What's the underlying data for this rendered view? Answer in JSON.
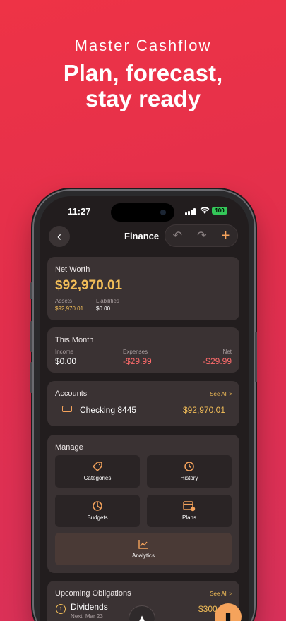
{
  "promo": {
    "subtitle": "Master Cashflow",
    "title_line1": "Plan, forecast,",
    "title_line2": "stay ready"
  },
  "status_bar": {
    "time": "11:27",
    "battery": "100"
  },
  "nav": {
    "title": "Finance",
    "icons": [
      "back-icon",
      "undo-icon",
      "redo-icon",
      "plus-icon"
    ]
  },
  "net_worth": {
    "title": "Net Worth",
    "amount": "$92,970.01",
    "assets_label": "Assets",
    "assets_value": "$92,970.01",
    "liabilities_label": "Liabilities",
    "liabilities_value": "$0.00"
  },
  "this_month": {
    "title": "This Month",
    "income_label": "Income",
    "income_value": "$0.00",
    "expenses_label": "Expenses",
    "expenses_value": "-$29.99",
    "net_label": "Net",
    "net_value": "-$29.99"
  },
  "accounts": {
    "title": "Accounts",
    "see_all": "See All >",
    "items": [
      {
        "name": "Checking 8445",
        "balance": "$92,970.01",
        "icon": "bank-card-icon"
      }
    ]
  },
  "manage": {
    "title": "Manage",
    "items": [
      {
        "label": "Categories",
        "icon": "tag-icon"
      },
      {
        "label": "History",
        "icon": "history-icon"
      },
      {
        "label": "Budgets",
        "icon": "pie-chart-icon"
      },
      {
        "label": "Plans",
        "icon": "calendar-icon"
      },
      {
        "label": "Analytics",
        "icon": "line-chart-icon"
      }
    ]
  },
  "obligations": {
    "title": "Upcoming Obligations",
    "see_all": "See All >",
    "items": [
      {
        "name": "Dividends",
        "next": "Next: Mar 23",
        "amount": "$300"
      }
    ]
  },
  "colors": {
    "background": "#ee3346",
    "accent": "#f5a35c",
    "gold": "#f3be58",
    "negative": "#ff6b6b",
    "card": "#3a3233"
  }
}
